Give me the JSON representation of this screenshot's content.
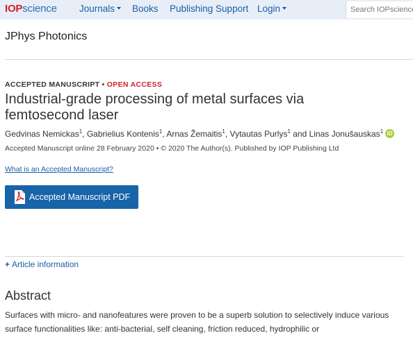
{
  "header": {
    "logo_iop": "IOP",
    "logo_science": "science",
    "nav": [
      "Journals",
      "Books",
      "Publishing Support",
      "Login"
    ],
    "search_placeholder": "Search IOPscience content"
  },
  "journal_name": "JPhys Photonics",
  "article": {
    "status": "ACCEPTED MANUSCRIPT",
    "separator": "•",
    "access": "OPEN ACCESS",
    "title": "Industrial-grade processing of metal surfaces via femtosecond laser",
    "authors": [
      {
        "name": "Gedvinas Nemickas",
        "aff": "1",
        "sep": ", "
      },
      {
        "name": "Gabrielius Kontenis",
        "aff": "1",
        "sep": ", "
      },
      {
        "name": "Arnas Žemaitis",
        "aff": "1",
        "sep": ", "
      },
      {
        "name": "Vytautas Purlys",
        "aff": "1",
        "sep": " and "
      },
      {
        "name": "Linas Jonušauskas",
        "aff": "1",
        "sep": ""
      }
    ],
    "orcid_label": "iD",
    "meta_line": "Accepted Manuscript online 28 February 2020 • © 2020 The Author(s). Published by IOP Publishing Ltd",
    "am_link": "What is an Accepted Manuscript?",
    "pdf_button": "Accepted Manuscript PDF",
    "article_info": "Article information",
    "article_info_prefix": "+"
  },
  "abstract": {
    "heading": "Abstract",
    "text": "Surfaces with micro- and nanofeatures were proven to be a superb solution to selectively induce various surface functionalities like: anti-bacterial, self cleaning, friction reduced, hydrophilic or"
  },
  "colors": {
    "brand_red": "#d4202a",
    "link_blue": "#1a5ea6",
    "button_blue": "#1764a8",
    "orcid_green": "#a6ce39",
    "header_bg": "#e8eef8"
  }
}
